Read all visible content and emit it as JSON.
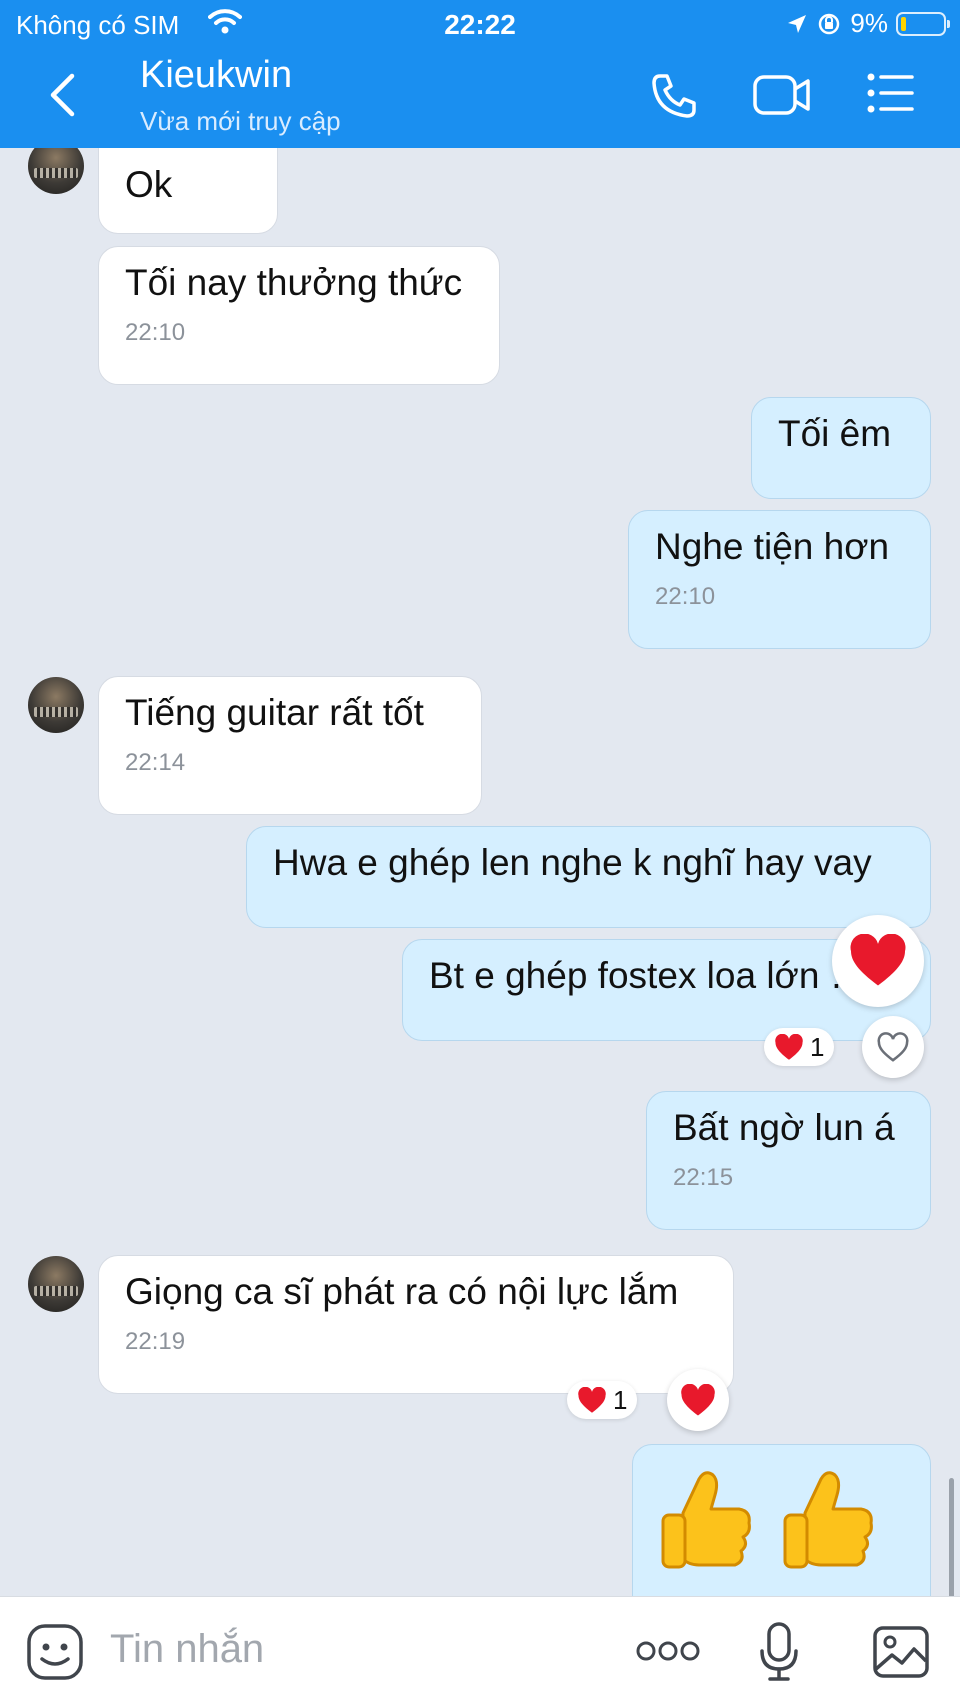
{
  "status_bar": {
    "carrier": "Không có SIM",
    "time": "22:22",
    "battery": "9%"
  },
  "header": {
    "contact_name": "Kieukwin",
    "contact_status": "Vừa mới truy cập"
  },
  "messages": [
    {
      "text": "Ok",
      "time": ""
    },
    {
      "text": "Tối nay thưởng thức",
      "time": "22:10"
    },
    {
      "text": "Tối êm",
      "time": ""
    },
    {
      "text": "Nghe tiện hơn",
      "time": "22:10"
    },
    {
      "text": "Tiếng guitar rất tốt",
      "time": "22:14"
    },
    {
      "text": "Hwa e ghép len nghe k nghĩ hay vay",
      "time": ""
    },
    {
      "text": "Bt e ghép fostex loa lớn …",
      "time": "",
      "reaction_count": "1"
    },
    {
      "text": "Bất ngờ lun á",
      "time": "22:15"
    },
    {
      "text": "Giọng ca sĩ phát ra có nội lực lắm",
      "time": "22:19",
      "reaction_count": "1"
    },
    {
      "text": "👍👍",
      "time": ""
    }
  ],
  "input": {
    "placeholder": "Tin nhắn"
  },
  "colors": {
    "header": "#1a8ff0",
    "chat_bg": "#e3e8f0",
    "outgoing": "#d5efff",
    "incoming": "#ffffff",
    "heart": "#e8192c"
  },
  "icons": [
    "back-icon",
    "phone-icon",
    "video-call-icon",
    "menu-icon",
    "sticker-icon",
    "more-icon",
    "microphone-icon",
    "image-icon",
    "heart-icon",
    "thumbs-up-icon"
  ]
}
